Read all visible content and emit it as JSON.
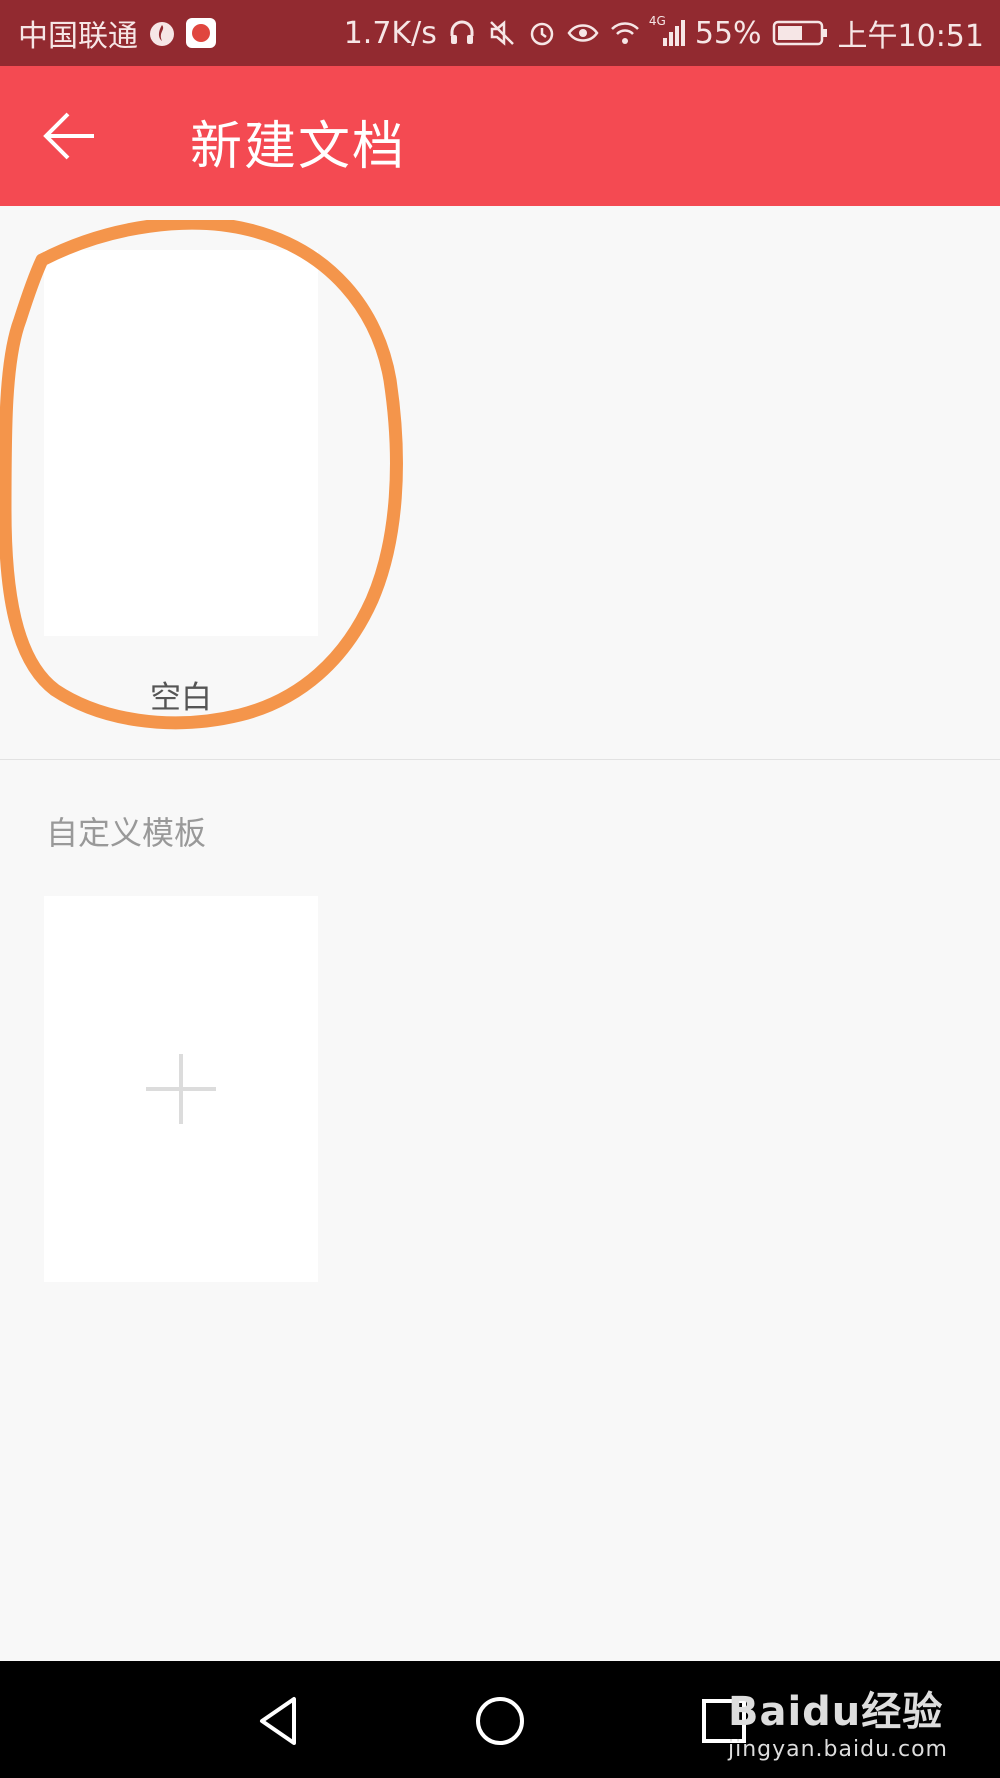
{
  "status_bar": {
    "carrier": "中国联通",
    "speed": "1.7K/s",
    "network": "4G",
    "battery": "55%",
    "time": "上午10:51"
  },
  "app_bar": {
    "title": "新建文档",
    "back_icon": "arrow-left-icon",
    "background": "#f44a52"
  },
  "templates": {
    "blank_label": "空白"
  },
  "custom_section": {
    "title": "自定义模板",
    "add_icon": "plus-icon"
  },
  "annotation": {
    "color": "#f4954b"
  },
  "watermark": {
    "brand": "Baidu经验",
    "url": "jingyan.baidu.com"
  }
}
